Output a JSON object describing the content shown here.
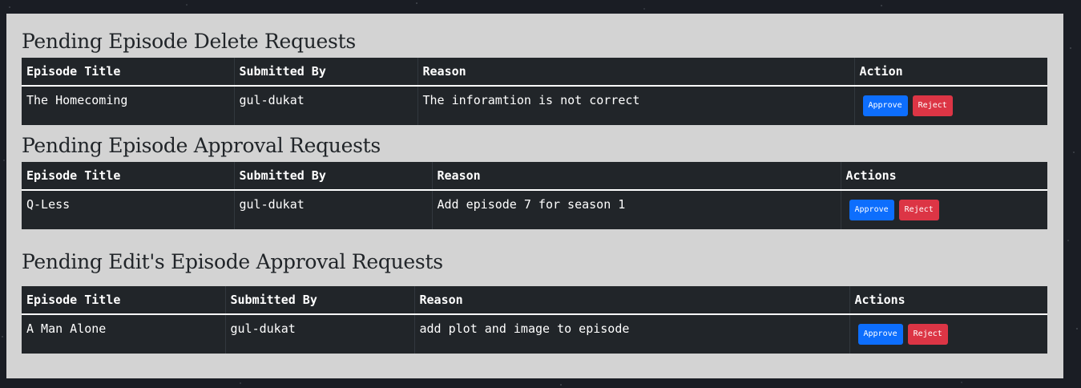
{
  "sections": {
    "delete": {
      "title": "Pending Episode Delete Requests",
      "headers": [
        "Episode Title",
        "Submitted By",
        "Reason",
        "Action"
      ],
      "rows": [
        {
          "title": "The Homecoming",
          "submitted_by": "gul-dukat",
          "reason": "The inforamtion is not correct",
          "approve": "Approve",
          "reject": "Reject"
        }
      ]
    },
    "approval": {
      "title": "Pending Episode Approval Requests",
      "headers": [
        "Episode Title",
        "Submitted By",
        "Reason",
        "Actions"
      ],
      "rows": [
        {
          "title": "Q-Less",
          "submitted_by": "gul-dukat",
          "reason": "Add episode 7 for season 1",
          "approve": "Approve",
          "reject": "Reject"
        }
      ]
    },
    "edit": {
      "title": "Pending Edit's Episode Approval Requests",
      "headers": [
        "Episode Title",
        "Submitted By",
        "Reason",
        "Actions"
      ],
      "rows": [
        {
          "title": "A Man Alone",
          "submitted_by": "gul-dukat",
          "reason": "add plot and image to episode",
          "approve": "Approve",
          "reject": "Reject"
        }
      ]
    }
  },
  "colors": {
    "table_bg": "#212529",
    "panel_bg": "#d3d3d3",
    "approve": "#0d6efd",
    "reject": "#dc3545"
  }
}
